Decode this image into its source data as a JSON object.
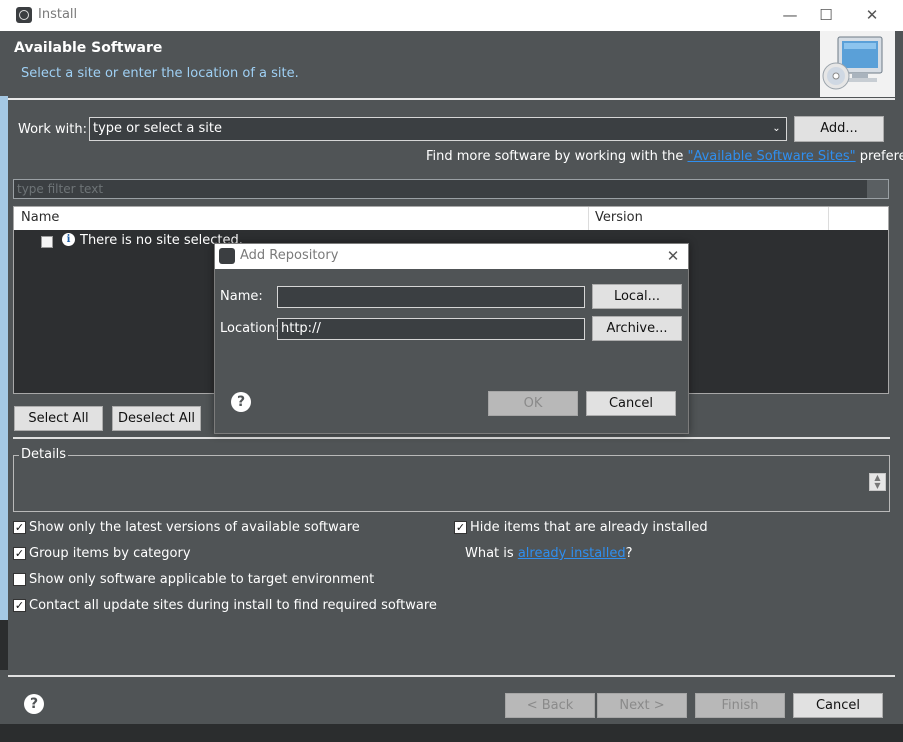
{
  "window": {
    "title": "Install",
    "minimize": "—",
    "maximize": "☐",
    "close": "✕"
  },
  "header": {
    "title": "Available Software",
    "subtitle": "Select a site or enter the location of a site."
  },
  "work_with": {
    "label": "Work with:",
    "value": "type or select a site",
    "add_button": "Add..."
  },
  "find_more": {
    "prefix": "Find more software by working with the ",
    "link": "\"Available Software Sites\"",
    "suffix": " preferences."
  },
  "filter": {
    "placeholder": "type filter text"
  },
  "table": {
    "columns": [
      "Name",
      "Version"
    ],
    "rows": [
      {
        "name": "There is no site selected.",
        "checked": false
      }
    ]
  },
  "selection_buttons": {
    "select_all": "Select All",
    "deselect_all": "Deselect All"
  },
  "details": {
    "label": "Details"
  },
  "options_left": [
    {
      "label": "Show only the latest versions of available software",
      "checked": true
    },
    {
      "label": "Group items by category",
      "checked": true
    },
    {
      "label": "Show only software applicable to target environment",
      "checked": false
    },
    {
      "label": "Contact all update sites during install to find required software",
      "checked": true
    }
  ],
  "options_right": {
    "hide_installed": {
      "label": "Hide items that are already installed",
      "checked": true
    },
    "what_is_prefix": "What is ",
    "what_is_link": "already installed",
    "what_is_suffix": "?"
  },
  "footer": {
    "back": "< Back",
    "next": "Next >",
    "finish": "Finish",
    "cancel": "Cancel"
  },
  "dialog": {
    "title": "Add Repository",
    "close": "✕",
    "name_label": "Name:",
    "name_value": "",
    "local_button": "Local...",
    "location_label": "Location:",
    "location_value": "http://",
    "archive_button": "Archive...",
    "ok": "OK",
    "cancel": "Cancel"
  },
  "colors": {
    "dialog_bg": "#505456",
    "input_bg": "#3b3f42",
    "link": "#2f8ff0",
    "subtitle": "#9fd0f4"
  },
  "icons": {
    "app": "eclipse-icon",
    "help": "question-mark-icon",
    "info": "info-icon",
    "wizard_banner": "computer-cd-icon"
  }
}
